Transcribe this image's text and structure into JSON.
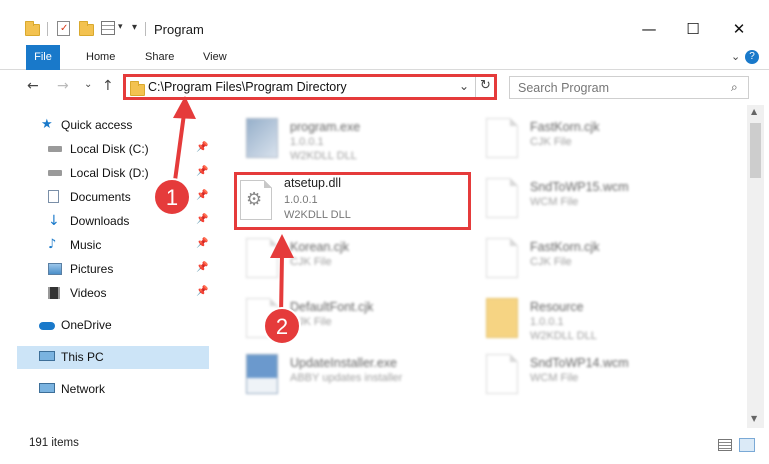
{
  "window": {
    "title": "Program",
    "minimize_glyph": "—",
    "maximize_glyph": "☐",
    "close_glyph": "✕"
  },
  "ribbon": {
    "tabs": [
      "File",
      "Home",
      "Share",
      "View"
    ]
  },
  "address": {
    "path": "C:\\Program Files\\Program Directory",
    "search_placeholder": "Search Program"
  },
  "sidebar": {
    "items": [
      {
        "label": "Quick access",
        "icon": "star-icon"
      },
      {
        "label": "Local Disk (C:)",
        "icon": "drive-icon"
      },
      {
        "label": "Local Disk (D:)",
        "icon": "drive-icon"
      },
      {
        "label": "Documents",
        "icon": "documents-icon"
      },
      {
        "label": "Downloads",
        "icon": "downloads-icon"
      },
      {
        "label": "Music",
        "icon": "music-icon"
      },
      {
        "label": "Pictures",
        "icon": "pictures-icon"
      },
      {
        "label": "Videos",
        "icon": "videos-icon"
      },
      {
        "label": "OneDrive",
        "icon": "cloud-icon"
      },
      {
        "label": "This PC",
        "icon": "computer-icon"
      },
      {
        "label": "Network",
        "icon": "network-icon"
      }
    ]
  },
  "files": {
    "left": [
      {
        "name": "program.exe",
        "line2": "1.0.0.1",
        "line3": "W2KDLL DLL"
      },
      {
        "name": "atsetup.dll",
        "line2": "1.0.0.1",
        "line3": "W2KDLL DLL"
      },
      {
        "name": "Korean.cjk",
        "line2": "CJK File",
        "line3": ""
      },
      {
        "name": "DefaultFont.cjk",
        "line2": "CJK File",
        "line3": ""
      },
      {
        "name": "UpdateInstaller.exe",
        "line2": "ABBY updates installer",
        "line3": ""
      }
    ],
    "right": [
      {
        "name": "FastKorn.cjk",
        "line2": "CJK File",
        "line3": ""
      },
      {
        "name": "SndToWP15.wcm",
        "line2": "WCM File",
        "line3": ""
      },
      {
        "name": "FastKorn.cjk",
        "line2": "CJK File",
        "line3": ""
      },
      {
        "name": "Resource",
        "line2": "1.0.0.1",
        "line3": "W2KDLL DLL"
      },
      {
        "name": "SndToWP14.wcm",
        "line2": "WCM File",
        "line3": ""
      }
    ]
  },
  "status": {
    "item_count": "191 items"
  },
  "callouts": [
    "1",
    "2"
  ],
  "colors": {
    "accent": "#1979ca",
    "annotation": "#e53b3b",
    "selection": "#cce4f7"
  }
}
